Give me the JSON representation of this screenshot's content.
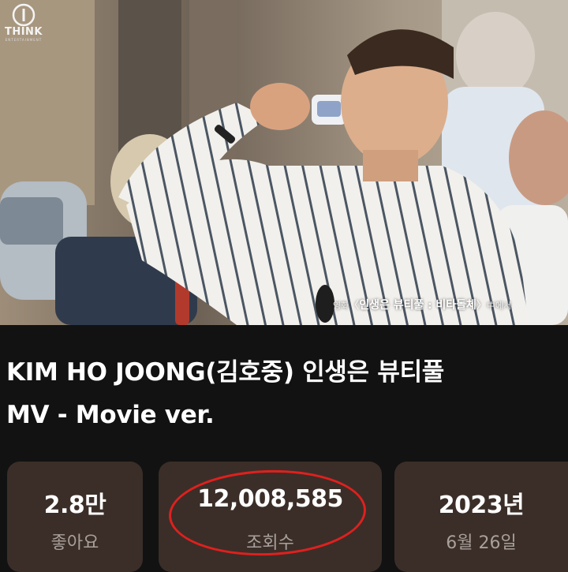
{
  "video": {
    "logo_text": "THINK",
    "logo_subtext": "ENTERTAINMENT",
    "caption_prefix": "영화",
    "caption_open": "〈",
    "caption_title": "인생은 뷰티풀 : 비타돌체",
    "caption_close": "〉",
    "caption_suffix": "中에서"
  },
  "title": {
    "line1": "KIM HO JOONG(김호중) 인생은 뷰티풀",
    "line2": "MV - Movie ver."
  },
  "stats": {
    "likes": {
      "value": "2.8만",
      "label": "좋아요"
    },
    "views": {
      "value": "12,008,585",
      "label": "조회수"
    },
    "date": {
      "value": "2023년",
      "label": "6월 26일"
    }
  },
  "colors": {
    "background": "#121212",
    "card": "#3b2e28",
    "highlight": "#e0201e",
    "label": "#a9a09b"
  }
}
